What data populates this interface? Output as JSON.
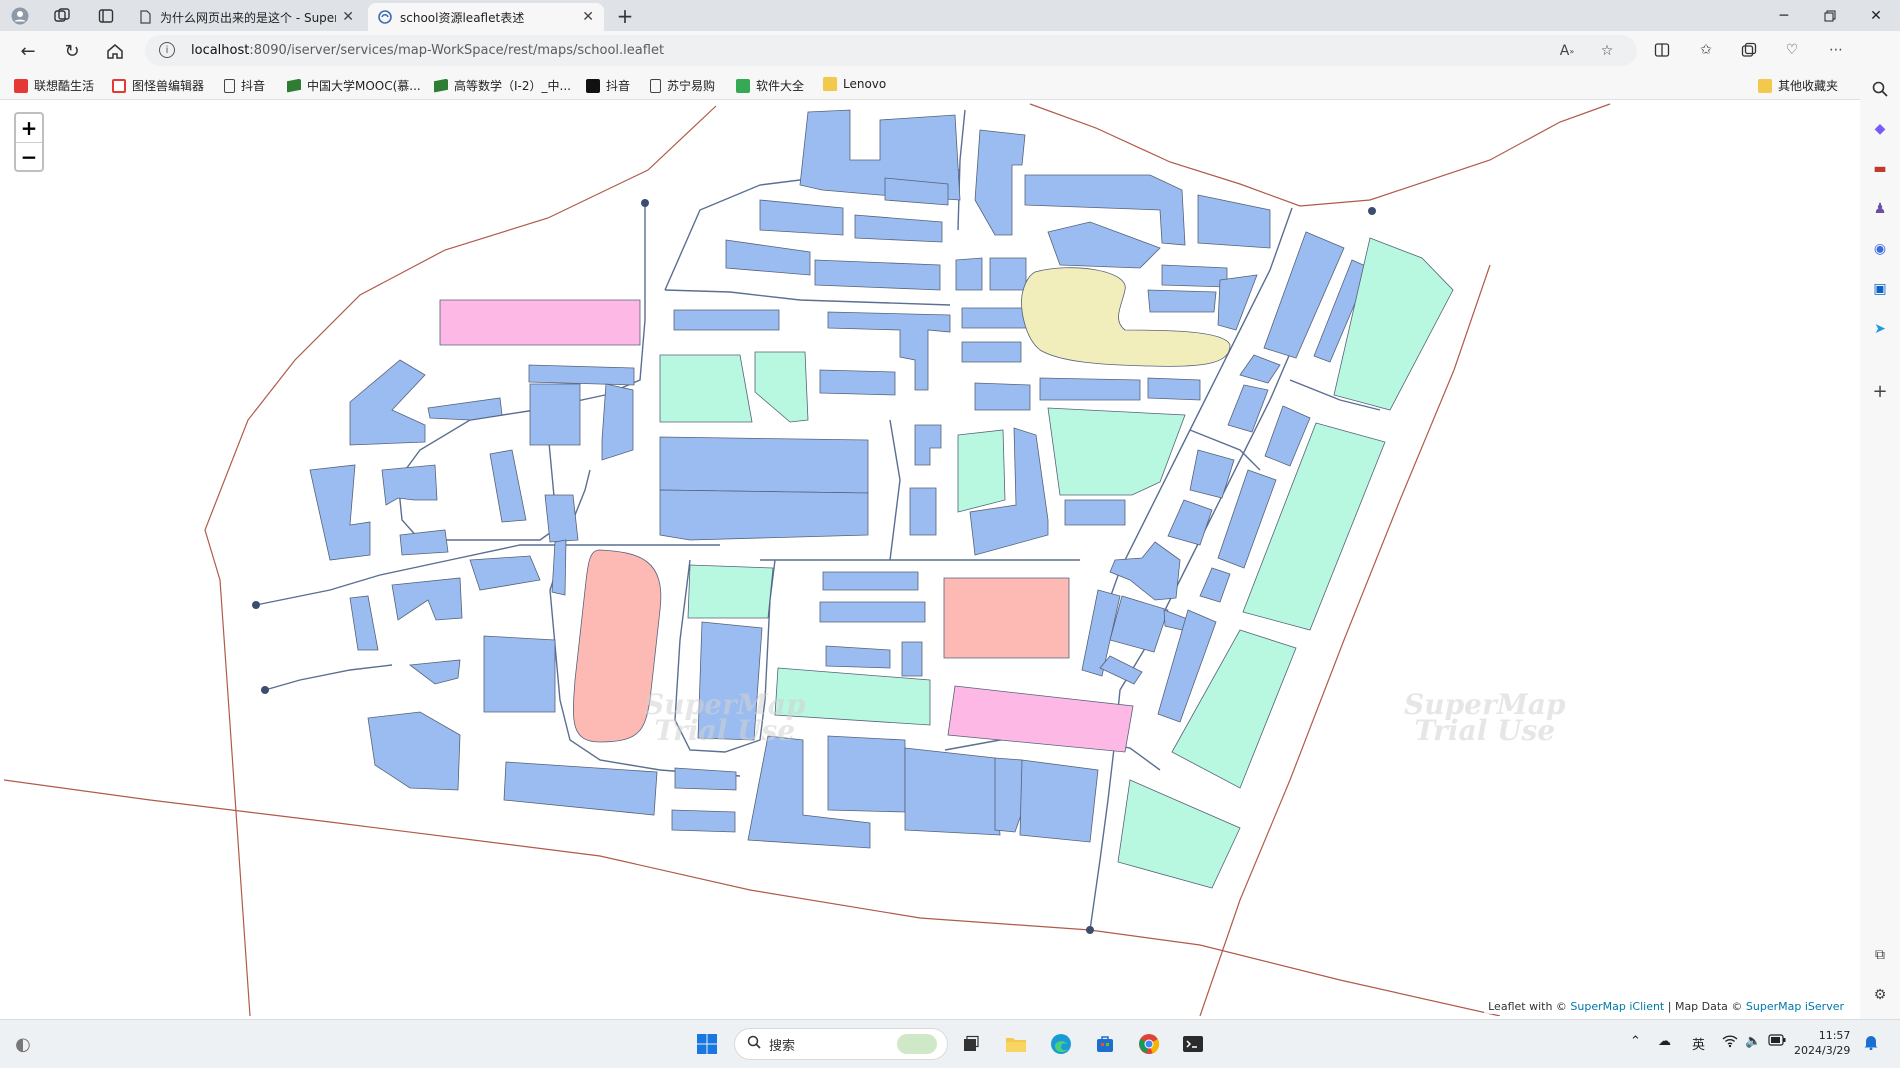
{
  "tabs": [
    {
      "title": "为什么网页出来的是这个 - Super",
      "active": false
    },
    {
      "title": "school资源leaflet表述",
      "active": true
    }
  ],
  "address": {
    "host": "localhost",
    "path": ":8090/iserver/services/map-WorkSpace/rest/maps/school.leaflet"
  },
  "bookmarks": [
    {
      "label": "联想酷生活",
      "icon": "lenovo-red-icon",
      "color": "#e53935"
    },
    {
      "label": "图怪兽编辑器",
      "icon": "tuguaishou-icon",
      "color": "#e53935"
    },
    {
      "label": "抖音",
      "icon": "page-icon",
      "color": "#ffffff"
    },
    {
      "label": "中国大学MOOC(慕...",
      "icon": "mooc-icon",
      "color": "#2e7d32"
    },
    {
      "label": "高等数学（I-2）_中...",
      "icon": "mooc-icon",
      "color": "#2e7d32"
    },
    {
      "label": "抖音",
      "icon": "douyin-icon",
      "color": "#111111"
    },
    {
      "label": "苏宁易购",
      "icon": "page-icon",
      "color": "#ffffff"
    },
    {
      "label": "软件大全",
      "icon": "download-icon",
      "color": "#34a853"
    },
    {
      "label": "Lenovo",
      "icon": "folder-icon",
      "color": "#f2c94c"
    }
  ],
  "other_bookmarks": "其他收藏夹",
  "map": {
    "zoom_in": "+",
    "zoom_out": "−",
    "attribution_prefix": "Leaflet with © ",
    "attribution_link1": "SuperMap iClient",
    "attribution_mid": " | Map Data © ",
    "attribution_link2": "SuperMap iServer",
    "watermark_line1": "SuperMap",
    "watermark_line2": "Trial Use",
    "colors": {
      "building": "#9bbcf0",
      "green": "#b8f7e0",
      "pink": "#fdb8e6",
      "salmon": "#fdbab5",
      "sand": "#f2eebb",
      "road": "#5a6f92",
      "boundary": "#b05a4a"
    }
  },
  "taskbar": {
    "search_label": "搜索",
    "ime": "英",
    "time": "11:57",
    "date": "2024/3/29"
  }
}
